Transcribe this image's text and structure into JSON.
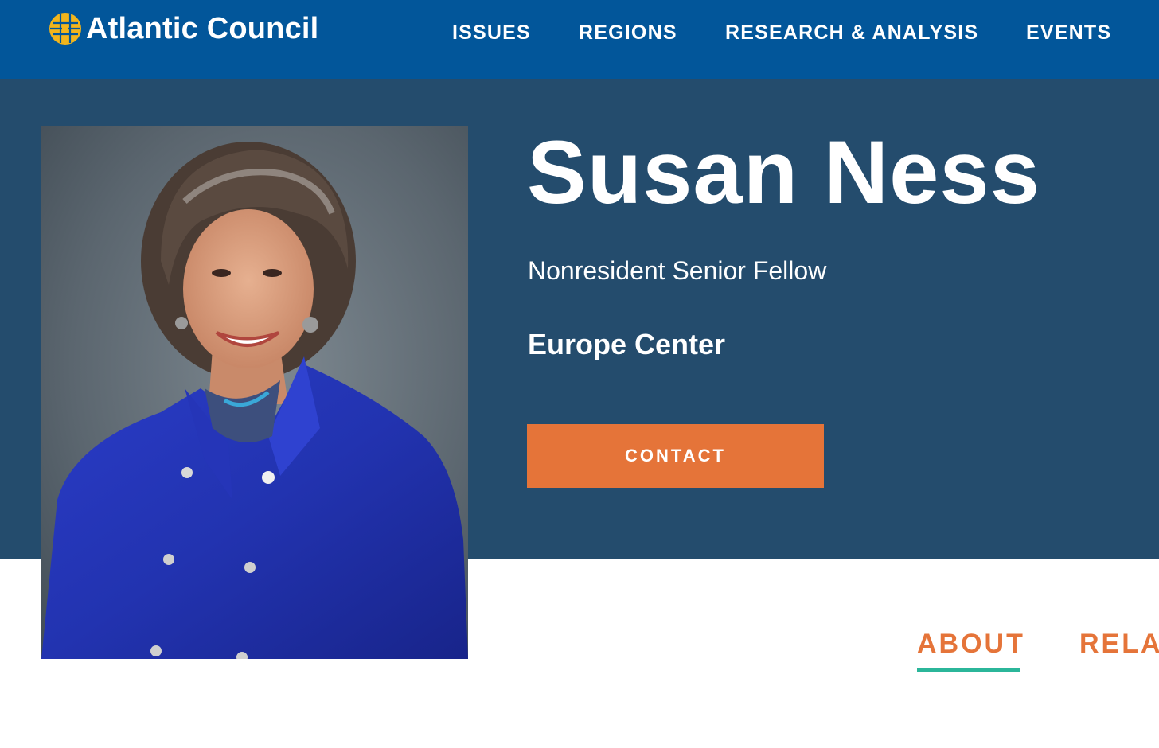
{
  "colors": {
    "header_bg": "#02569a",
    "hero_bg": "#244c6d",
    "contact_button": "#e57439",
    "tab_text": "#e57439",
    "tab_active_underline": "#2bb69a",
    "logo_gold": "#f2b51c"
  },
  "header": {
    "logo_icon": "globe-logo-icon",
    "brand_name": "Atlantic Council",
    "nav": [
      {
        "label": "ISSUES"
      },
      {
        "label": "REGIONS"
      },
      {
        "label": "RESEARCH & ANALYSIS"
      },
      {
        "label": "EVENTS"
      }
    ]
  },
  "profile": {
    "name": "Susan Ness",
    "title": "Nonresident Senior Fellow",
    "center": "Europe Center",
    "contact_label": "CONTACT",
    "photo": "portrait-photo"
  },
  "tabs": [
    {
      "label": "ABOUT",
      "active": true
    },
    {
      "label": "RELATED",
      "active": false
    }
  ]
}
